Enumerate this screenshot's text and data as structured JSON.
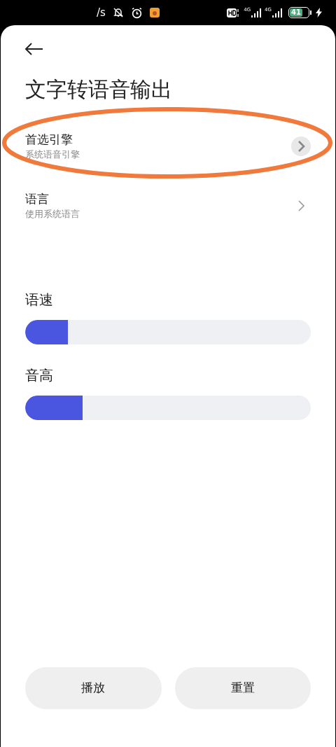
{
  "status_bar": {
    "speed": "/s",
    "network_labels": [
      "4G",
      "4G"
    ],
    "battery": "41"
  },
  "title": "文字转语音输出",
  "settings": [
    {
      "title": "首选引擎",
      "subtitle": "系统语音引擎",
      "pressed": true,
      "circled": true
    },
    {
      "title": "语言",
      "subtitle": "使用系统语言",
      "pressed": false,
      "circled": false
    }
  ],
  "sliders": [
    {
      "label": "语速",
      "level": 0.15
    },
    {
      "label": "音高",
      "level": 0.2
    }
  ],
  "buttons": [
    "播放",
    "重置"
  ]
}
